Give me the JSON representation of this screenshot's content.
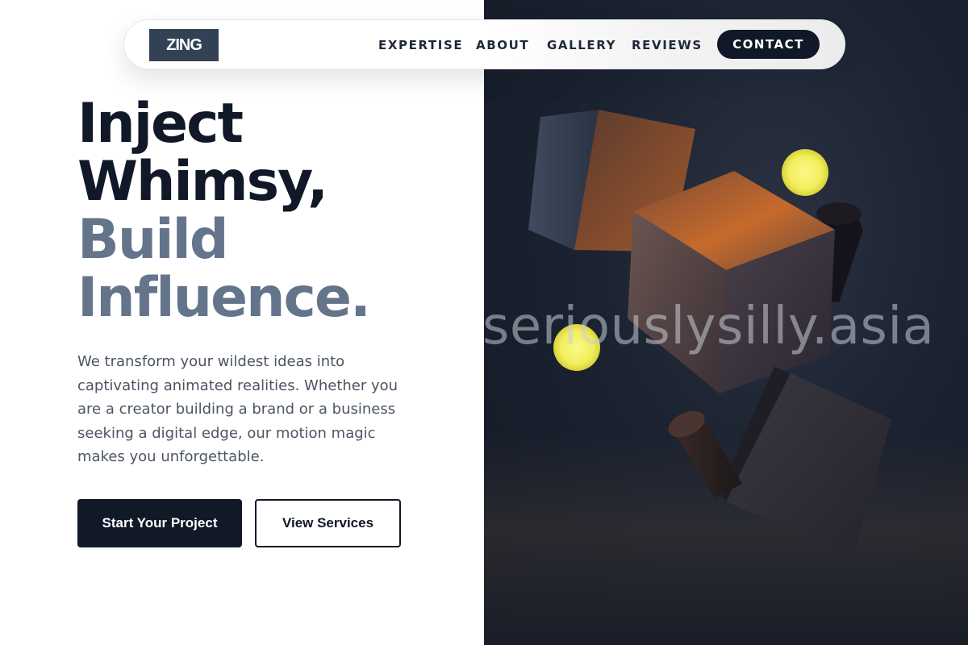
{
  "brand": {
    "logo_text": "ZING"
  },
  "nav": {
    "links": [
      {
        "label": "EXPERTISE"
      },
      {
        "label": "ABOUT"
      },
      {
        "label": "GALLERY"
      },
      {
        "label": "REVIEWS"
      }
    ],
    "contact_label": "CONTACT"
  },
  "hero": {
    "headline_line1": "Inject",
    "headline_line2": "Whimsy,",
    "headline_line3": "Build",
    "headline_line4": "Influence.",
    "description": "We transform your wildest ideas into captivating animated realities. Whether you are a creator building a brand or a business seeking a digital edge, our motion magic makes you unforgettable.",
    "primary_cta": "Start Your Project",
    "secondary_cta": "View Services"
  },
  "image": {
    "watermark": "seriouslysilly.asia"
  },
  "colors": {
    "navy": "#111827",
    "slate": "#64748b",
    "logo_bg": "#334155",
    "glow_yellow": "#f7f36a",
    "cube_orange": "#c2642a"
  }
}
